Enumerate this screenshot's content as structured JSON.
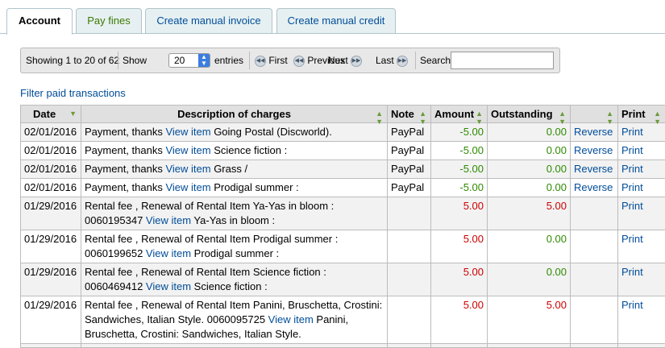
{
  "tabs": {
    "account": "Account",
    "pay_fines": "Pay fines",
    "create_invoice": "Create manual invoice",
    "create_credit": "Create manual credit"
  },
  "toolbar": {
    "showing": "Showing 1 to 20 of 62",
    "show_label": "Show",
    "entries_value": "20",
    "entries_label": "entries",
    "first": "First",
    "previous": "Previous",
    "next": "Next",
    "last": "Last",
    "search_label": "Search:",
    "search_value": ""
  },
  "filter_link": "Filter paid transactions",
  "table": {
    "headers": {
      "date": "Date",
      "description": "Description of charges",
      "note": "Note",
      "amount": "Amount",
      "outstanding": "Outstanding",
      "action": "",
      "print": "Print"
    },
    "rows": [
      {
        "date": "02/01/2016",
        "desc_before": "Payment, thanks ",
        "view": "View item",
        "desc_after": " Going Postal (Discworld).",
        "note": "PayPal",
        "amount": "-5.00",
        "outstanding": "0.00",
        "action": "Reverse",
        "print": "Print"
      },
      {
        "date": "02/01/2016",
        "desc_before": "Payment, thanks ",
        "view": "View item",
        "desc_after": " Science fiction :",
        "note": "PayPal",
        "amount": "-5.00",
        "outstanding": "0.00",
        "action": "Reverse",
        "print": "Print"
      },
      {
        "date": "02/01/2016",
        "desc_before": "Payment, thanks ",
        "view": "View item",
        "desc_after": " Grass /",
        "note": "PayPal",
        "amount": "-5.00",
        "outstanding": "0.00",
        "action": "Reverse",
        "print": "Print"
      },
      {
        "date": "02/01/2016",
        "desc_before": "Payment, thanks ",
        "view": "View item",
        "desc_after": " Prodigal summer :",
        "note": "PayPal",
        "amount": "-5.00",
        "outstanding": "0.00",
        "action": "Reverse",
        "print": "Print"
      },
      {
        "date": "01/29/2016",
        "desc_before": "Rental fee , Renewal of Rental Item Ya-Yas in bloom : 0060195347 ",
        "view": "View item",
        "desc_after": " Ya-Yas in bloom :",
        "note": "",
        "amount": "5.00",
        "outstanding": "5.00",
        "action": "",
        "print": "Print"
      },
      {
        "date": "01/29/2016",
        "desc_before": "Rental fee , Renewal of Rental Item Prodigal summer : 0060199652 ",
        "view": "View item",
        "desc_after": " Prodigal summer :",
        "note": "",
        "amount": "5.00",
        "outstanding": "0.00",
        "action": "",
        "print": "Print"
      },
      {
        "date": "01/29/2016",
        "desc_before": "Rental fee , Renewal of Rental Item Science fiction : 0060469412 ",
        "view": "View item",
        "desc_after": " Science fiction :",
        "note": "",
        "amount": "5.00",
        "outstanding": "0.00",
        "action": "",
        "print": "Print"
      },
      {
        "date": "01/29/2016",
        "desc_before": "Rental fee , Renewal of Rental Item Panini, Bruschetta, Crostini: Sandwiches, Italian Style. 0060095725 ",
        "view": "View item",
        "desc_after": " Panini, Bruschetta, Crostini: Sandwiches, Italian Style.",
        "note": "",
        "amount": "5.00",
        "outstanding": "5.00",
        "action": "",
        "print": "Print"
      },
      {
        "date": "",
        "desc_before": "",
        "view": "",
        "desc_after": "",
        "note": "",
        "amount": "",
        "outstanding": "",
        "action": "",
        "print": ""
      }
    ]
  },
  "colors": {
    "link": "#004d99",
    "negative_amount": "#2e8b00",
    "positive_amount": "#cc0000",
    "header_bg": "#e0e0e0"
  }
}
